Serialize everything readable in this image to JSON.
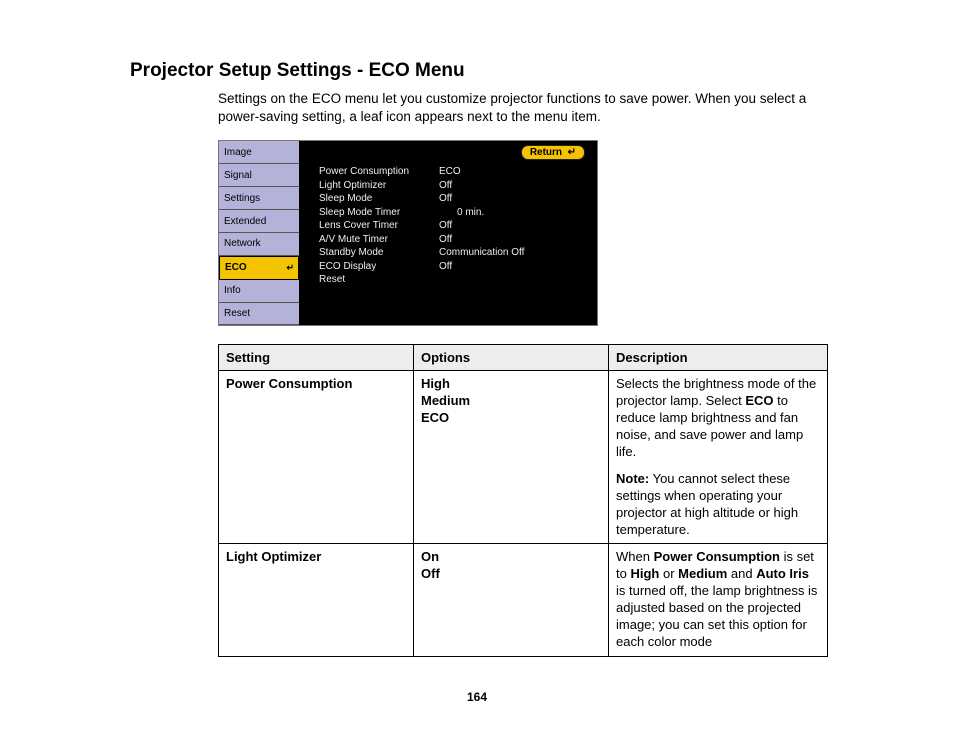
{
  "title": "Projector Setup Settings - ECO Menu",
  "intro": "Settings on the ECO menu let you customize projector functions to save power. When you select a power-saving setting, a leaf icon appears next to the menu item.",
  "menu": {
    "sidebar": [
      "Image",
      "Signal",
      "Settings",
      "Extended",
      "Network",
      "ECO",
      "Info",
      "Reset"
    ],
    "active_index": 5,
    "return_label": "Return",
    "rows": [
      {
        "k": "Power Consumption",
        "v": "ECO"
      },
      {
        "k": "Light Optimizer",
        "v": "Off"
      },
      {
        "k": "Sleep Mode",
        "v": "Off"
      },
      {
        "k": "Sleep Mode Timer",
        "v": "0 min."
      },
      {
        "k": "Lens Cover Timer",
        "v": "Off"
      },
      {
        "k": "A/V Mute Timer",
        "v": "Off"
      },
      {
        "k": "Standby Mode",
        "v": "Communication Off"
      },
      {
        "k": "ECO Display",
        "v": "Off"
      },
      {
        "k": "Reset",
        "v": ""
      }
    ]
  },
  "table": {
    "headers": [
      "Setting",
      "Options",
      "Description"
    ],
    "rows": [
      {
        "setting": "Power Consumption",
        "options": [
          "High",
          "Medium",
          "ECO"
        ],
        "desc_main_pre": "Selects the brightness mode of the projector lamp. Select ",
        "desc_main_bold": "ECO",
        "desc_main_post": " to reduce lamp brightness and fan noise, and save power and lamp life.",
        "note_label": "Note:",
        "note_body": " You cannot select these settings when operating your projector at high altitude or high temperature."
      },
      {
        "setting": "Light Optimizer",
        "options": [
          "On",
          "Off"
        ],
        "desc_pre": "When ",
        "b1": "Power Consumption",
        "mid1": " is set to ",
        "b2": "High",
        "mid2": " or ",
        "b3": "Medium",
        "mid3": " and ",
        "b4": "Auto Iris",
        "desc_post": " is turned off, the lamp brightness is adjusted based on the projected image; you can set this option for each color mode"
      }
    ]
  },
  "page_number": "164"
}
